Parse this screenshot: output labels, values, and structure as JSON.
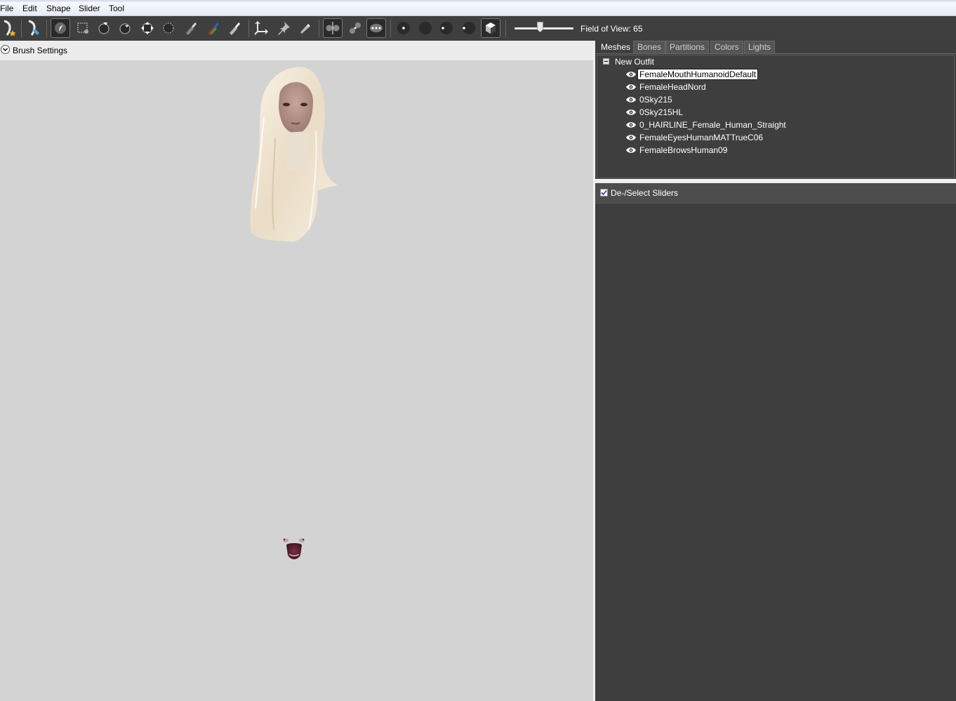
{
  "menu": {
    "file": "File",
    "edit": "Edit",
    "shape": "Shape",
    "slider": "Slider",
    "tool": "Tool"
  },
  "toolbar": {
    "fov_label": "Field of View: 65",
    "fov_value": 65
  },
  "brush": {
    "label": "Brush Settings"
  },
  "tabs": [
    {
      "label": "Meshes",
      "active": true
    },
    {
      "label": "Bones",
      "active": false
    },
    {
      "label": "Partitions",
      "active": false
    },
    {
      "label": "Colors",
      "active": false
    },
    {
      "label": "Lights",
      "active": false
    }
  ],
  "tree": {
    "root": "New Outfit",
    "meshes": [
      "FemaleMouthHumanoidDefault",
      "FemaleHeadNord",
      "0Sky215",
      "0Sky215HL",
      "0_HAIRLINE_Female_Human_Straight",
      "FemaleEyesHumanMATTrueC06",
      "FemaleBrowsHuman09"
    ],
    "selected_index": 0
  },
  "sliders": {
    "deselect_label": "De-/Select Sliders",
    "checked": true
  },
  "colors": {
    "panel": "#3e3e3e",
    "toolbar": "#3f3f3f",
    "viewport": "#d3d3d3"
  }
}
